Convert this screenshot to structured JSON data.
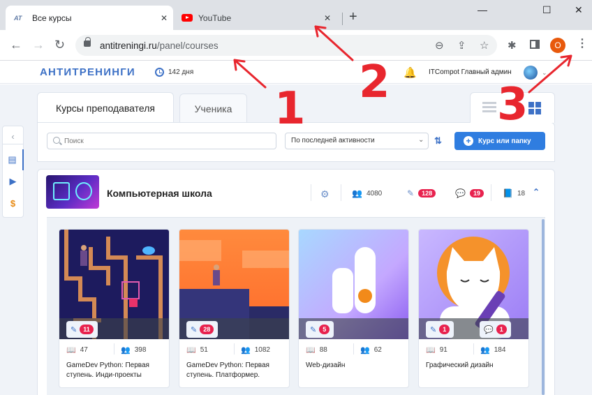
{
  "browser": {
    "tabs": [
      {
        "favicon": "at-logo-icon",
        "title": "Все курсы",
        "close": "✕"
      },
      {
        "favicon": "youtube-icon",
        "title": "YouTube",
        "close": "✕"
      }
    ],
    "new_tab": "+",
    "window": {
      "minimize": "—",
      "maximize": "☐",
      "close": "✕"
    },
    "url_host": "antitreningi.ru",
    "url_path": "/panel/courses",
    "profile_letter": "O"
  },
  "app": {
    "logo": "АНТИТРЕНИНГИ",
    "days": "142 дня",
    "admin": "ITCompot Главный админ",
    "tabs": {
      "teacher": "Курсы преподавателя",
      "student": "Ученика"
    },
    "search_placeholder": "Поиск",
    "sort_select": "По последней активности",
    "sort_icon": "⇅",
    "add_button": "Курс или папку",
    "colors": {
      "brand": "#3d71c6",
      "button": "#2f7de0",
      "badge": "#e8224e",
      "annotation": "#e8262e"
    }
  },
  "folder": {
    "name": "Компьютерная школа",
    "students": "4080",
    "homework_badge": "128",
    "comments_badge": "19",
    "lessons": "18"
  },
  "courses": [
    {
      "homework": "11",
      "lessons": "47",
      "students": "398",
      "title": "GameDev Python: Первая ступень. Инди-проекты"
    },
    {
      "homework": "28",
      "lessons": "51",
      "students": "1082",
      "title": "GameDev Python: Первая ступень. Платформер."
    },
    {
      "homework": "5",
      "lessons": "88",
      "students": "62",
      "title": "Web-дизайн"
    },
    {
      "homework": "1",
      "comments": "1",
      "lessons": "91",
      "students": "184",
      "title": "Графический дизайн"
    }
  ],
  "annotations": [
    "1",
    "2",
    "3"
  ]
}
